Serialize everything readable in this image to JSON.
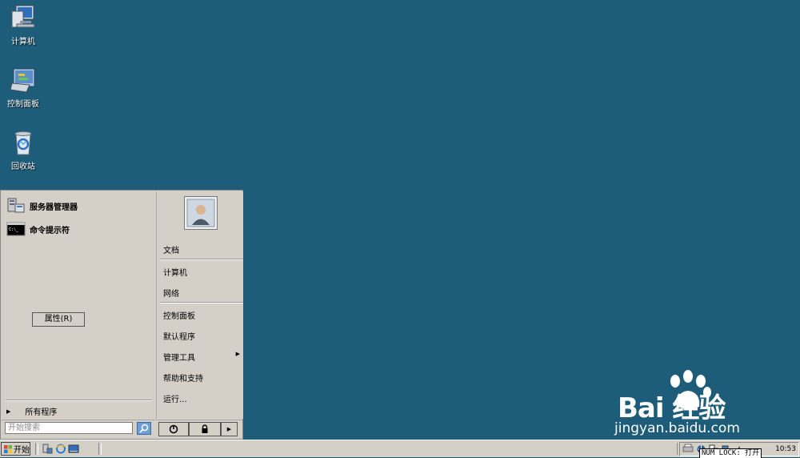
{
  "desktop": {
    "icons": [
      {
        "label": "计算机",
        "icon": "computer-icon"
      },
      {
        "label": "控制面板",
        "icon": "control-panel-icon"
      },
      {
        "label": "回收站",
        "icon": "recycle-bin-icon"
      }
    ]
  },
  "start_menu": {
    "pinned": [
      {
        "label": "服务器管理器",
        "icon": "server-manager-icon"
      },
      {
        "label": "命令提示符",
        "icon": "command-prompt-icon"
      }
    ],
    "properties_button": "属性(R)",
    "all_programs": "所有程序",
    "search_placeholder": "开始搜索",
    "right_items": [
      {
        "label": "文档"
      },
      {
        "label": "计算机"
      },
      {
        "label": "网络"
      },
      {
        "label": "控制面板"
      },
      {
        "label": "默认程序"
      },
      {
        "label": "管理工具"
      },
      {
        "label": "帮助和支持"
      },
      {
        "label": "运行..."
      }
    ]
  },
  "taskbar": {
    "start_label": "开始",
    "clock": "10:53",
    "numlock": "NUM LOCK: 打开"
  },
  "watermark": {
    "brand_text": "Bai  经验",
    "url": "jingyan.baidu.com"
  },
  "colors": {
    "desktop_background": "#1d5d7a",
    "menu_background": "#d4d0c8"
  }
}
